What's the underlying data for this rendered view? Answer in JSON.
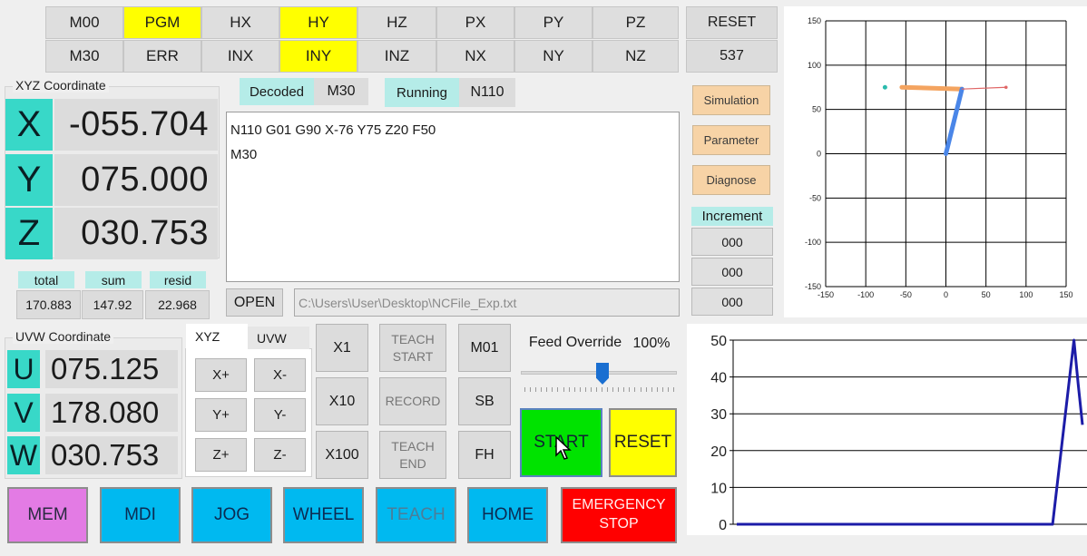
{
  "status_grid": {
    "row1": [
      {
        "label": "M00",
        "color": "#dedede"
      },
      {
        "label": "PGM",
        "color": "#ffff00"
      },
      {
        "label": "HX",
        "color": "#dedede"
      },
      {
        "label": "HY",
        "color": "#ffff00"
      },
      {
        "label": "HZ",
        "color": "#dedede"
      },
      {
        "label": "PX",
        "color": "#dedede"
      },
      {
        "label": "PY",
        "color": "#dedede"
      },
      {
        "label": "PZ",
        "color": "#dedede"
      }
    ],
    "row2": [
      {
        "label": "M30",
        "color": "#dedede"
      },
      {
        "label": "ERR",
        "color": "#dedede"
      },
      {
        "label": "INX",
        "color": "#dedede"
      },
      {
        "label": "INY",
        "color": "#ffff00"
      },
      {
        "label": "INZ",
        "color": "#dedede"
      },
      {
        "label": "NX",
        "color": "#dedede"
      },
      {
        "label": "NY",
        "color": "#dedede"
      },
      {
        "label": "NZ",
        "color": "#dedede"
      }
    ],
    "reset_label": "RESET",
    "counter": "537"
  },
  "xyz": {
    "title": "XYZ Coordinate",
    "x_label": "X",
    "x_value": "-055.704",
    "y_label": "Y",
    "y_value": "075.000",
    "z_label": "Z",
    "z_value": "030.753"
  },
  "stats": {
    "total_label": "total",
    "total_value": "170.883",
    "sum_label": "sum",
    "sum_value": "147.92",
    "resid_label": "resid",
    "resid_value": "22.968"
  },
  "decode": {
    "decoded_label": "Decoded",
    "decoded_value": "M30",
    "running_label": "Running",
    "running_value": "N110"
  },
  "nc_program": {
    "line1": "N110 G01 G90 X-76 Y75 Z20 F50",
    "line2": "M30",
    "open_label": "OPEN",
    "path": "C:\\Users\\User\\Desktop\\NCFile_Exp.txt"
  },
  "side_buttons": {
    "simulation": "Simulation",
    "parameter": "Parameter",
    "diagnose": "Diagnose"
  },
  "increment": {
    "label": "Increment",
    "values": [
      "000",
      "000",
      "000"
    ]
  },
  "uvw": {
    "title": "UVW Coordinate",
    "u_label": "U",
    "u_value": "075.125",
    "v_label": "V",
    "v_value": "178.080",
    "w_label": "W",
    "w_value": "030.753"
  },
  "jog_tabs": {
    "tab_xyz": "XYZ",
    "tab_uvw": "UVW",
    "xp": "X+",
    "xm": "X-",
    "yp": "Y+",
    "ym": "Y-",
    "zp": "Z+",
    "zm": "Z-"
  },
  "multipliers": {
    "x1": "X1",
    "x10": "X10",
    "x100": "X100"
  },
  "teach": {
    "start": "TEACH START",
    "record": "RECORD",
    "end": "TEACH END"
  },
  "mcodes": {
    "m01": "M01",
    "sb": "SB",
    "fh": "FH"
  },
  "feed": {
    "label": "Feed Override",
    "value": "100%",
    "fraction": 0.5
  },
  "run": {
    "start": "START",
    "reset": "RESET"
  },
  "modes": {
    "mem": "MEM",
    "mdi": "MDI",
    "jog": "JOG",
    "wheel": "WHEEL",
    "teach": "TEACH",
    "home": "HOME",
    "estop_line1": "EMERGENCY",
    "estop_line2": "STOP"
  },
  "chart_data": [
    {
      "type": "scatter",
      "title": "",
      "xlim": [
        -150,
        150
      ],
      "ylim": [
        -150,
        150
      ],
      "xticks": [
        -150,
        -100,
        -50,
        0,
        50,
        100,
        150
      ],
      "yticks": [
        150,
        100,
        50,
        0,
        -50,
        -100,
        -150
      ],
      "grid": true,
      "series": [
        {
          "color": "#f4a460",
          "points": [
            [
              -55,
              75
            ],
            [
              20,
              73
            ]
          ]
        },
        {
          "color": "#4a86e8",
          "points": [
            [
              0,
              0
            ],
            [
              20,
              73
            ]
          ]
        },
        {
          "color": "#e06666",
          "points": [
            [
              20,
              73
            ],
            [
              75,
              75
            ]
          ]
        },
        {
          "color": "#2bbbad",
          "points": [
            [
              -76,
              75
            ]
          ]
        }
      ]
    },
    {
      "type": "line",
      "title": "",
      "ylim": [
        0,
        50
      ],
      "yticks": [
        50,
        40,
        30,
        20,
        10,
        0
      ],
      "grid": true,
      "series": [
        {
          "color": "#1c1ca8",
          "values": [
            0,
            0,
            0,
            0,
            0,
            0,
            0,
            0,
            0,
            0,
            0,
            0,
            0,
            0,
            0,
            0,
            0,
            0,
            0,
            0,
            0,
            0,
            0,
            0,
            0,
            0,
            0,
            0,
            0,
            0,
            0,
            0,
            0,
            0,
            0,
            0,
            0,
            0,
            0,
            0,
            0,
            0,
            0,
            0,
            0,
            0,
            0,
            0,
            0,
            0,
            0,
            0,
            0,
            0,
            0,
            0,
            0,
            0,
            0,
            0,
            0,
            0,
            0,
            0,
            0,
            0,
            0,
            0,
            0,
            0,
            0,
            0,
            0,
            0,
            0,
            10,
            20,
            30,
            40,
            50,
            38,
            27
          ]
        }
      ]
    }
  ]
}
